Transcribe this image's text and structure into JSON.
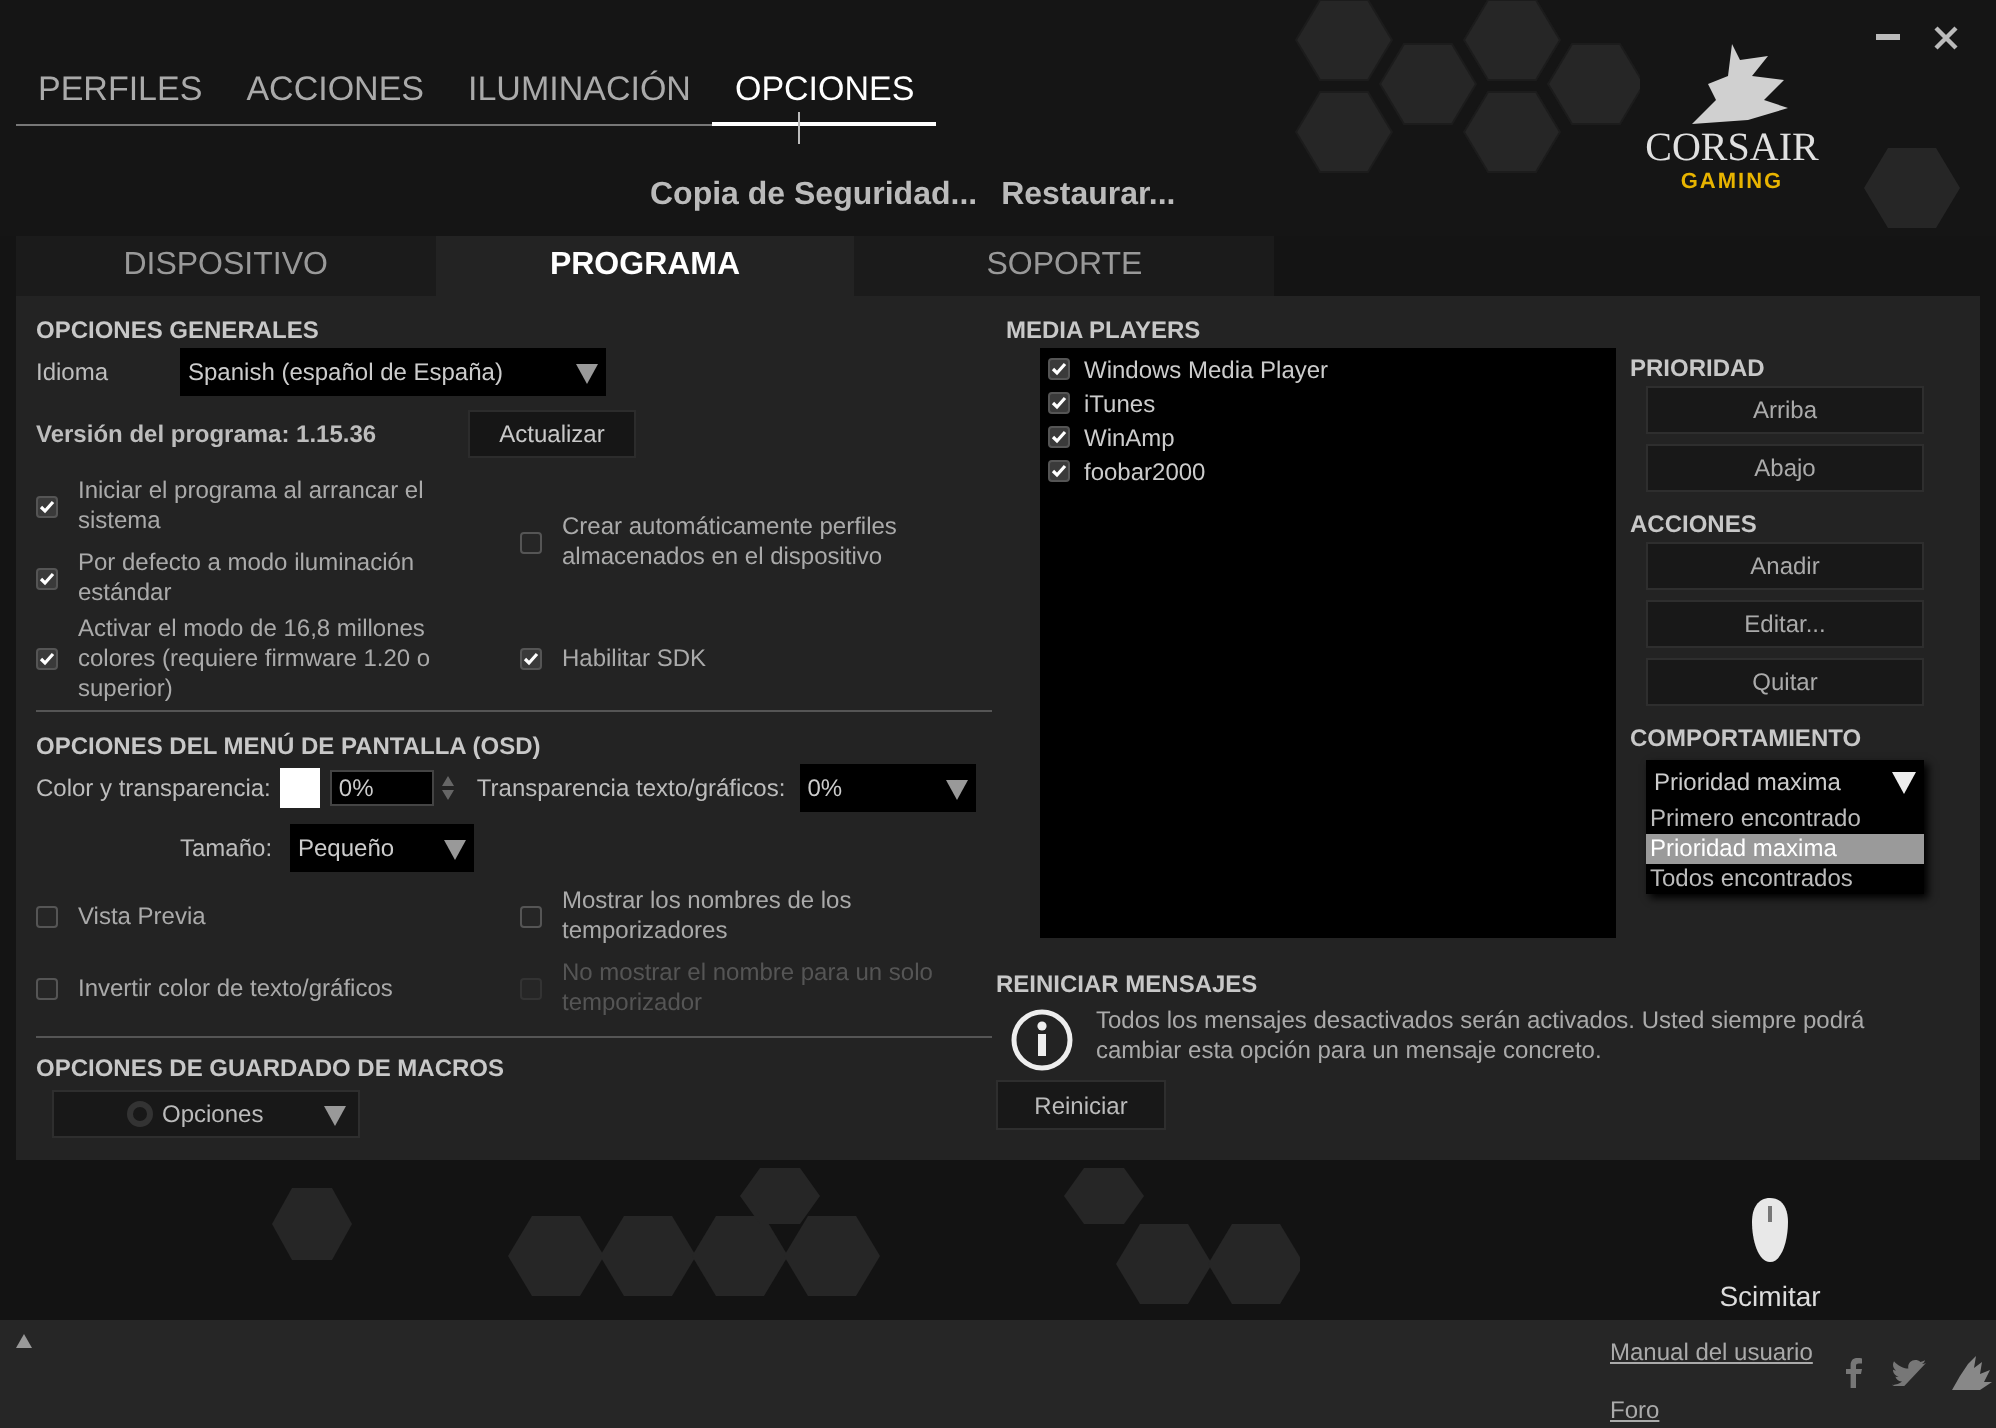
{
  "nav_tabs": [
    {
      "label": "PERFILES",
      "selected": false
    },
    {
      "label": "ACCIONES",
      "selected": false
    },
    {
      "label": "ILUMINACIÓN",
      "selected": false
    },
    {
      "label": "OPCIONES",
      "selected": true
    }
  ],
  "header_links": [
    "Copia de Seguridad...",
    "Restaurar..."
  ],
  "logo": {
    "name": "CORSAIR",
    "tagline": "GAMING"
  },
  "section_tabs": [
    {
      "label": "DISPOSITIVO",
      "selected": false
    },
    {
      "label": "PROGRAMA",
      "selected": true
    },
    {
      "label": "SOPORTE",
      "selected": false
    }
  ],
  "general": {
    "title": "OPCIONES GENERALES",
    "language_label": "Idioma",
    "language_value": "Spanish (español de España)",
    "version": "Versión del programa: 1.15.36",
    "update_button": "Actualizar",
    "options_left": [
      {
        "label": "Iniciar el programa al arrancar el sistema",
        "checked": true
      },
      {
        "label": "Por defecto a modo iluminación estándar",
        "checked": true
      },
      {
        "label": "Activar el modo de 16,8 millones colores (requiere firmware 1.20 o superior)",
        "checked": true
      }
    ],
    "options_right": [
      {
        "label": "Crear automáticamente perfiles almacenados en el dispositivo",
        "checked": false
      },
      {
        "label": "Habilitar SDK",
        "checked": true
      }
    ]
  },
  "osd": {
    "title": "OPCIONES DEL MENÚ DE PANTALLA (OSD)",
    "color_label": "Color y transparencia:",
    "color_percent": "0%",
    "text_transparency_label": "Transparencia texto/gráficos:",
    "text_transparency_value": "0%",
    "size_label": "Tamaño:",
    "size_value": "Pequeño",
    "options": [
      {
        "label": "Vista Previa",
        "checked": false,
        "disabled": false
      },
      {
        "label": "Mostrar los nombres de los temporizadores",
        "checked": false,
        "disabled": false
      },
      {
        "label": "Invertir color de texto/gráficos",
        "checked": false,
        "disabled": false
      },
      {
        "label": "No mostrar el nombre para un solo temporizador",
        "checked": false,
        "disabled": true
      }
    ]
  },
  "macros": {
    "title": "OPCIONES DE GUARDADO DE MACROS",
    "button": "Opciones"
  },
  "media_players": {
    "title": "MEDIA PLAYERS",
    "items": [
      {
        "label": "Windows Media Player",
        "checked": true
      },
      {
        "label": "iTunes",
        "checked": true
      },
      {
        "label": "WinAmp",
        "checked": true
      },
      {
        "label": "foobar2000",
        "checked": true
      }
    ]
  },
  "priority": {
    "title": "PRIORIDAD",
    "buttons": [
      "Arriba",
      "Abajo"
    ]
  },
  "actions": {
    "title": "ACCIONES",
    "buttons": [
      "Anadir",
      "Editar...",
      "Quitar"
    ]
  },
  "behavior": {
    "title": "COMPORTAMIENTO",
    "value": "Prioridad maxima",
    "options": [
      {
        "label": "Primero encontrado",
        "selected": false
      },
      {
        "label": "Prioridad maxima",
        "selected": true
      },
      {
        "label": "Todos encontrados",
        "selected": false
      }
    ]
  },
  "reset_messages": {
    "title": "REINICIAR MENSAJES",
    "text": "Todos los mensajes desactivados serán activados. Usted siempre podrá cambiar esta opción para un mensaje concreto.",
    "button": "Reiniciar"
  },
  "device": {
    "name": "Scimitar"
  },
  "footer": {
    "links": [
      "Manual del usuario",
      "Foro"
    ]
  }
}
